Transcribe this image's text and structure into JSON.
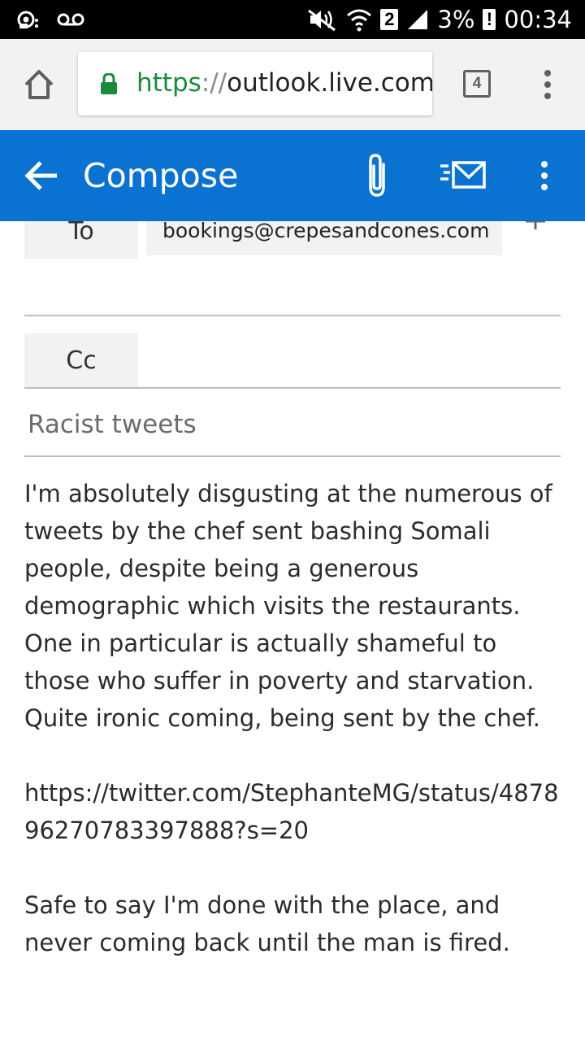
{
  "status_bar": {
    "left_icons": [
      "wifi-call-icon",
      "voicemail-icon"
    ],
    "right_icons": [
      "mute-icon",
      "wifi-icon",
      "signal-icon"
    ],
    "sim_badge": "2",
    "battery_percent": "3%",
    "battery_alert": "!",
    "time": "00:34"
  },
  "browser": {
    "url_scheme": "https",
    "url_separator": "://",
    "url_host": "outlook.live.com/",
    "tab_count": "4",
    "icons": [
      "home-icon",
      "lock-icon",
      "overflow-menu-icon"
    ]
  },
  "app_bar": {
    "title": "Compose",
    "icons": [
      "back-arrow-icon",
      "paperclip-icon",
      "send-icon",
      "overflow-menu-icon"
    ],
    "color": "#0a72d1"
  },
  "compose": {
    "to_label": "To",
    "to_recipient": "bookings@crepesandcones.com",
    "cc_label": "Cc",
    "cc_value": "",
    "subject": "Racist tweets",
    "body_paragraph_1": "I'm absolutely disgusting at the numerous of tweets by the chef sent bashing Somali people, despite being a generous demographic which visits the restaurants. One in particular is actually shameful to those who suffer in poverty and starvation. Quite ironic coming, being sent by the chef.",
    "body_link": "https://twitter.com/StephanteMG/status/487896270783397888?s=20",
    "body_paragraph_2": "Safe to say I'm done with the place, and never coming back until the man is fired."
  }
}
